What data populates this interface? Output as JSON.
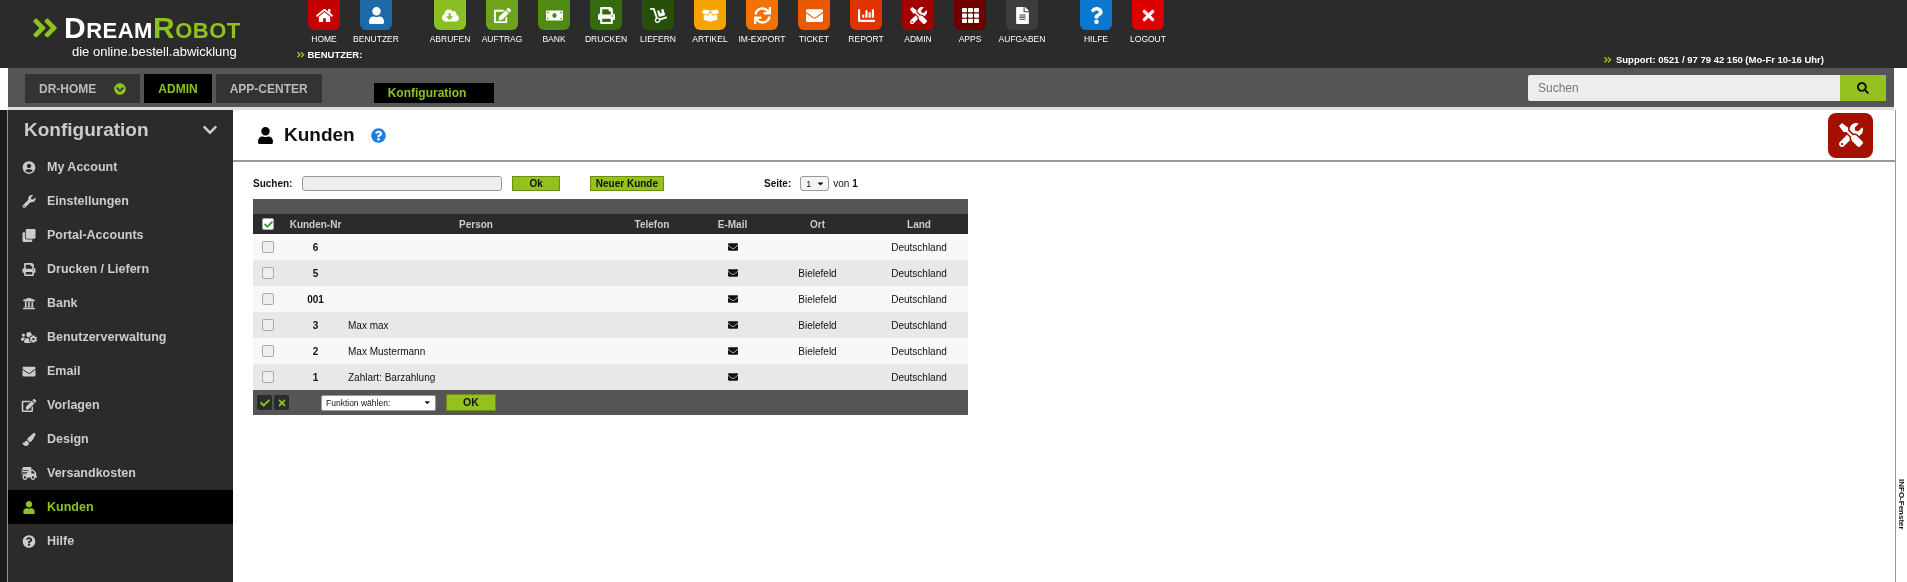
{
  "logo": {
    "word_1": "DREAM",
    "word_2": "ROBOT",
    "tagline": "die online.bestell.abwicklung"
  },
  "toolbar_groups": [
    [
      {
        "label": "HOME",
        "color": "#c40000"
      },
      {
        "label": "BENUTZER",
        "color": "#1d6aa8"
      }
    ],
    [
      {
        "label": "ABRUFEN",
        "color": "#8cbf26"
      },
      {
        "label": "AUFTRAG",
        "color": "#6ea31c"
      },
      {
        "label": "BANK",
        "color": "#4f8a12"
      },
      {
        "label": "DRUCKEN",
        "color": "#356b0e"
      },
      {
        "label": "LIEFERN",
        "color": "#274f0a"
      },
      {
        "label": "ARTIKEL",
        "color": "#f6a200"
      },
      {
        "label": "IM-EXPORT",
        "color": "#f57200"
      },
      {
        "label": "TICKET",
        "color": "#ea5800"
      },
      {
        "label": "REPORT",
        "color": "#e03300"
      },
      {
        "label": "ADMIN",
        "color": "#a30000"
      },
      {
        "label": "APPS",
        "color": "#6e0000"
      },
      {
        "label": "AUFGABEN",
        "color": "#3c3c3c"
      }
    ],
    [
      {
        "label": "HILFE",
        "color": "#0a78d0"
      },
      {
        "label": "LOGOUT",
        "color": "#dd0000"
      }
    ]
  ],
  "user_label": "BENUTZER:",
  "support": "Support: 0521 / 97 79 42 150 (Mo-Fr 10-16 Uhr)",
  "nav_tabs": [
    {
      "label": "DR-HOME",
      "selected": false
    },
    {
      "label": "ADMIN",
      "selected": true
    },
    {
      "label": "APP-CENTER",
      "selected": false
    }
  ],
  "sub_tabs": [
    {
      "label": "Konfiguration",
      "selected": true
    }
  ],
  "global_search": {
    "placeholder": "Suchen"
  },
  "sidebar": {
    "title": "Konfiguration",
    "items": [
      {
        "label": "My Account",
        "selected": false
      },
      {
        "label": "Einstellungen",
        "selected": false
      },
      {
        "label": "Portal-Accounts",
        "selected": false
      },
      {
        "label": "Drucken / Liefern",
        "selected": false
      },
      {
        "label": "Bank",
        "selected": false
      },
      {
        "label": "Benutzerverwaltung",
        "selected": false
      },
      {
        "label": "Email",
        "selected": false
      },
      {
        "label": "Vorlagen",
        "selected": false
      },
      {
        "label": "Design",
        "selected": false
      },
      {
        "label": "Versandkosten",
        "selected": false
      },
      {
        "label": "Kunden",
        "selected": true
      },
      {
        "label": "Hilfe",
        "selected": false
      }
    ]
  },
  "page": {
    "title": "Kunden"
  },
  "filter": {
    "label": "Suchen:",
    "ok": "Ok",
    "new": "Neuer Kunde",
    "page_label": "Seite:",
    "page": "1",
    "of": "von",
    "pages": "1"
  },
  "table": {
    "all_checked": true,
    "columns": [
      "Kunden-Nr",
      "Person",
      "Telefon",
      "E-Mail",
      "Ort",
      "Land"
    ],
    "rows": [
      {
        "checked": false,
        "nr": "6",
        "person": "",
        "ort": "",
        "land": "Deutschland"
      },
      {
        "checked": false,
        "nr": "5",
        "person": "",
        "ort": "Bielefeld",
        "land": "Deutschland"
      },
      {
        "checked": false,
        "nr": "001",
        "person": "",
        "ort": "Bielefeld",
        "land": "Deutschland"
      },
      {
        "checked": false,
        "nr": "3",
        "person": "Max max",
        "ort": "Bielefeld",
        "land": "Deutschland"
      },
      {
        "checked": false,
        "nr": "2",
        "person": "Max Mustermann",
        "ort": "Bielefeld",
        "land": "Deutschland"
      },
      {
        "checked": false,
        "nr": "1",
        "person": "Zahlart: Barzahlung",
        "ort": "",
        "land": "Deutschland"
      }
    ],
    "function_select": "Funktion wählen:",
    "ok": "OK"
  },
  "info_panel": "INFO-Fenster"
}
